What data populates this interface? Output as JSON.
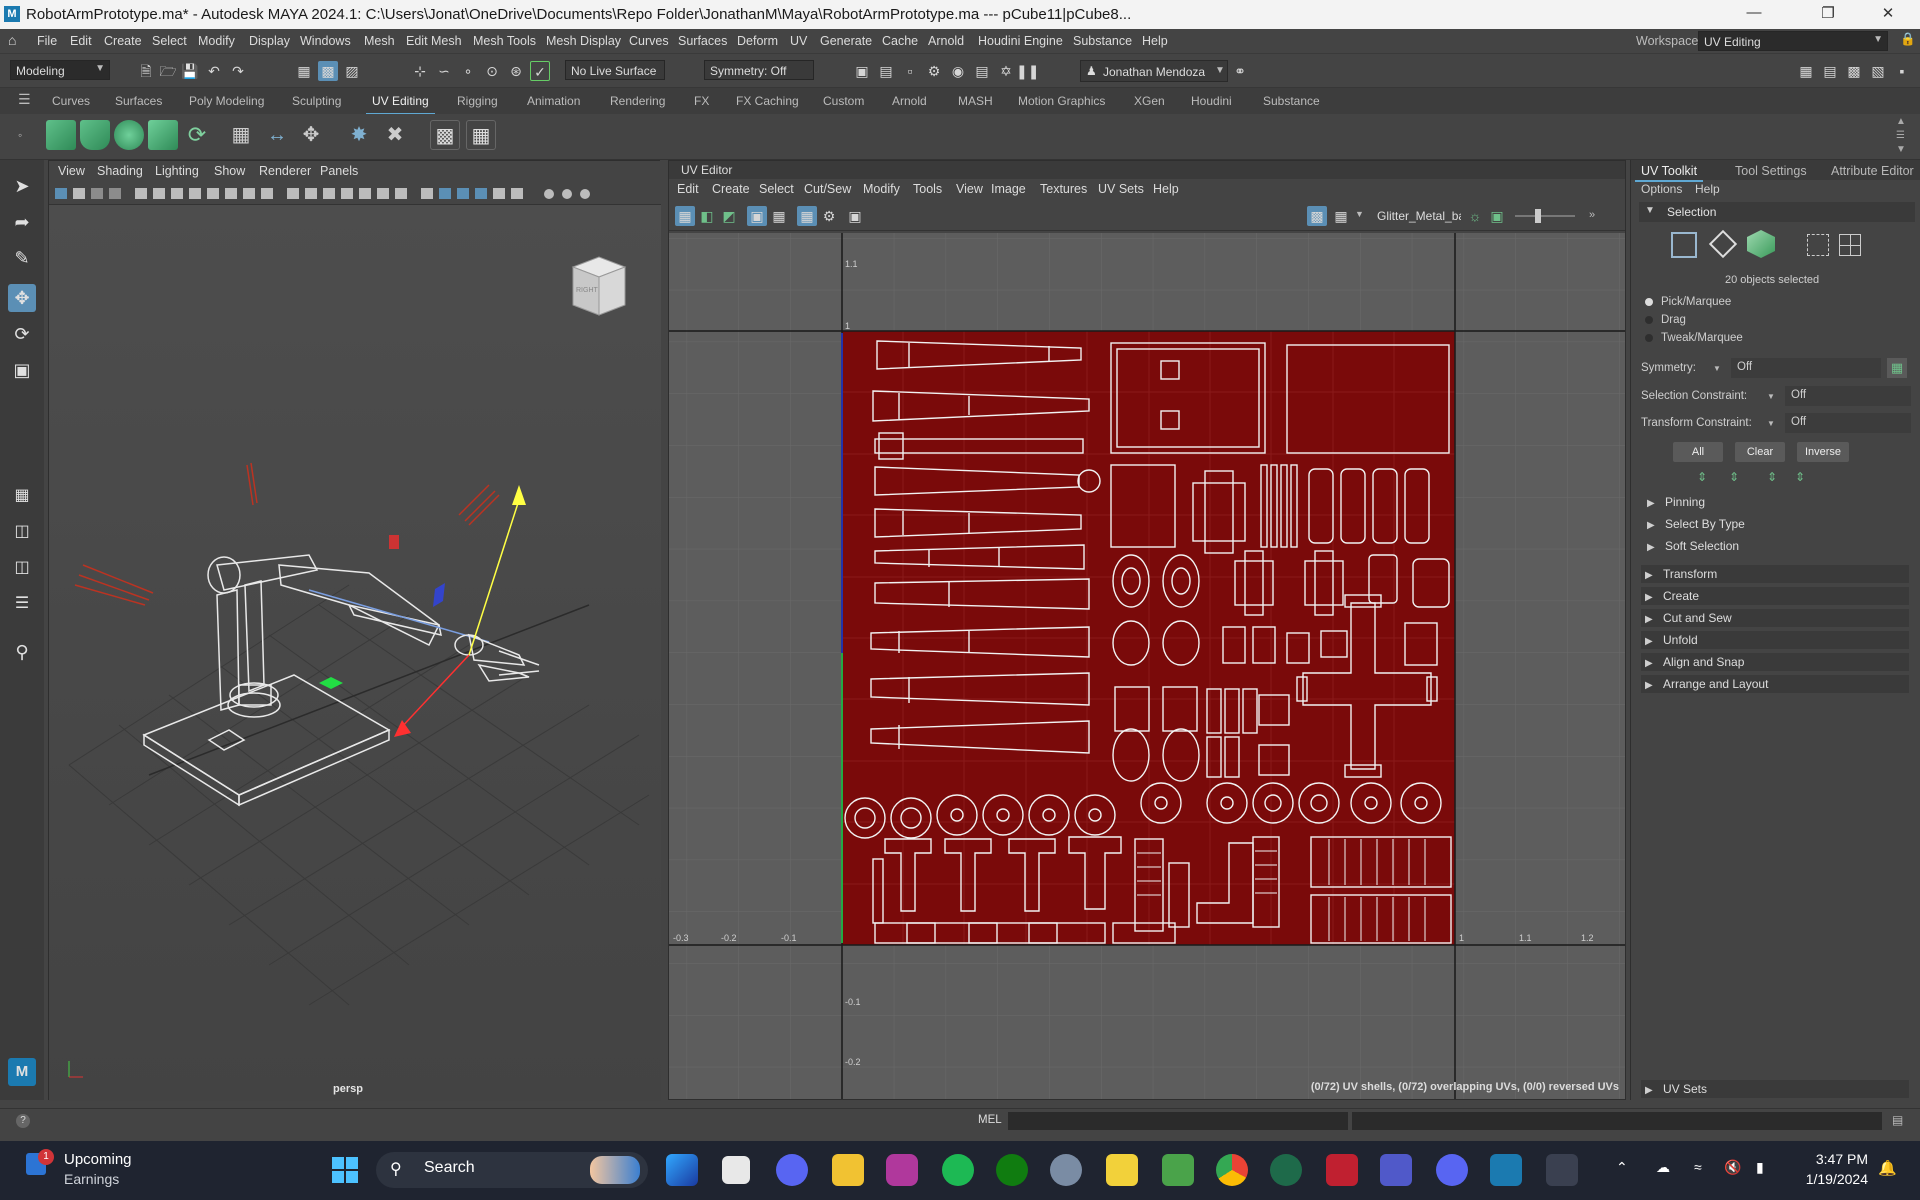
{
  "window": {
    "title": "RobotArmPrototype.ma* - Autodesk MAYA 2024.1: C:\\Users\\Jonat\\OneDrive\\Documents\\Repo Folder\\JonathanM\\Maya\\RobotArmPrototype.ma   ---   pCube11|pCube8...",
    "app_icon": "maya-icon"
  },
  "menubar": {
    "items": [
      "File",
      "Edit",
      "Create",
      "Select",
      "Modify",
      "Display",
      "Windows",
      "Mesh",
      "Edit Mesh",
      "Mesh Tools",
      "Mesh Display",
      "Curves",
      "Surfaces",
      "Deform",
      "UV",
      "Generate",
      "Cache",
      "Arnold",
      "Houdini Engine",
      "Substance",
      "Help"
    ],
    "workspace_label": "Workspace:",
    "workspace_value": "UV Editing"
  },
  "statusline": {
    "menuset": "Modeling",
    "live_surface": "No Live Surface",
    "symmetry": "Symmetry: Off",
    "user": "Jonathan Mendoza"
  },
  "shelf": {
    "tabs": [
      "Curves",
      "Surfaces",
      "Poly Modeling",
      "Sculpting",
      "UV Editing",
      "Rigging",
      "Animation",
      "Rendering",
      "FX",
      "FX Caching",
      "Custom",
      "Arnold",
      "MASH",
      "Motion Graphics",
      "XGen",
      "Houdini",
      "Substance"
    ],
    "active_tab": "UV Editing"
  },
  "viewport": {
    "menus": [
      "View",
      "Shading",
      "Lighting",
      "Show",
      "Renderer",
      "Panels"
    ],
    "camera_label": "persp",
    "viewcube_label": "RIGHT"
  },
  "uv_editor": {
    "panel_title": "UV Editor",
    "menus": [
      "Edit",
      "Create",
      "Select",
      "Cut/Sew",
      "Modify",
      "Tools",
      "View",
      "Image",
      "Textures",
      "UV Sets",
      "Help"
    ],
    "texture_name": "Glitter_Metal_basecol",
    "status": "(0/72) UV shells, (0/72) overlapping UVs, (0/0) reversed UVs",
    "tile_color": "#7a0a0a",
    "axis_labels_x": [
      "-0.3",
      "-0.2",
      "-0.1",
      "1",
      "1.1",
      "1.2"
    ],
    "axis_labels_y": [
      "1.1",
      "1",
      "-0.1",
      "-0.2"
    ]
  },
  "uv_toolkit": {
    "tabs": [
      "UV Toolkit",
      "Tool Settings",
      "Attribute Editor"
    ],
    "menus": [
      "Options",
      "Help"
    ],
    "selection_header": "Selection",
    "selected_count": "20 objects selected",
    "modes": [
      "Pick/Marquee",
      "Drag",
      "Tweak/Marquee"
    ],
    "symmetry_label": "Symmetry:",
    "symmetry_value": "Off",
    "selection_constraint_label": "Selection Constraint:",
    "selection_constraint_value": "Off",
    "transform_constraint_label": "Transform Constraint:",
    "transform_constraint_value": "Off",
    "buttons": [
      "All",
      "Clear",
      "Inverse"
    ],
    "subsections": [
      "Pinning",
      "Select By Type",
      "Soft Selection"
    ],
    "sections": [
      "Transform",
      "Create",
      "Cut and Sew",
      "Unfold",
      "Align and Snap",
      "Arrange and Layout"
    ],
    "uv_sets": "UV Sets"
  },
  "commandline": {
    "label": "MEL"
  },
  "taskbar": {
    "widget_title": "Upcoming",
    "widget_subtitle": "Earnings",
    "widget_badge": "1",
    "search_label": "Search",
    "time": "3:47 PM",
    "date": "1/19/2024",
    "pinned_apps": [
      "photoshop-icon",
      "files-icon",
      "discord-icon",
      "file-explorer-icon",
      "instagram-icon",
      "spotify-icon",
      "xbox-icon",
      "settings-icon",
      "tick-icon",
      "minecraft-icon",
      "chrome-icon",
      "sims-icon",
      "nxt-icon",
      "teams-icon",
      "discord-chat-icon",
      "maya-taskbar-icon",
      "snipping-tool-icon"
    ]
  }
}
